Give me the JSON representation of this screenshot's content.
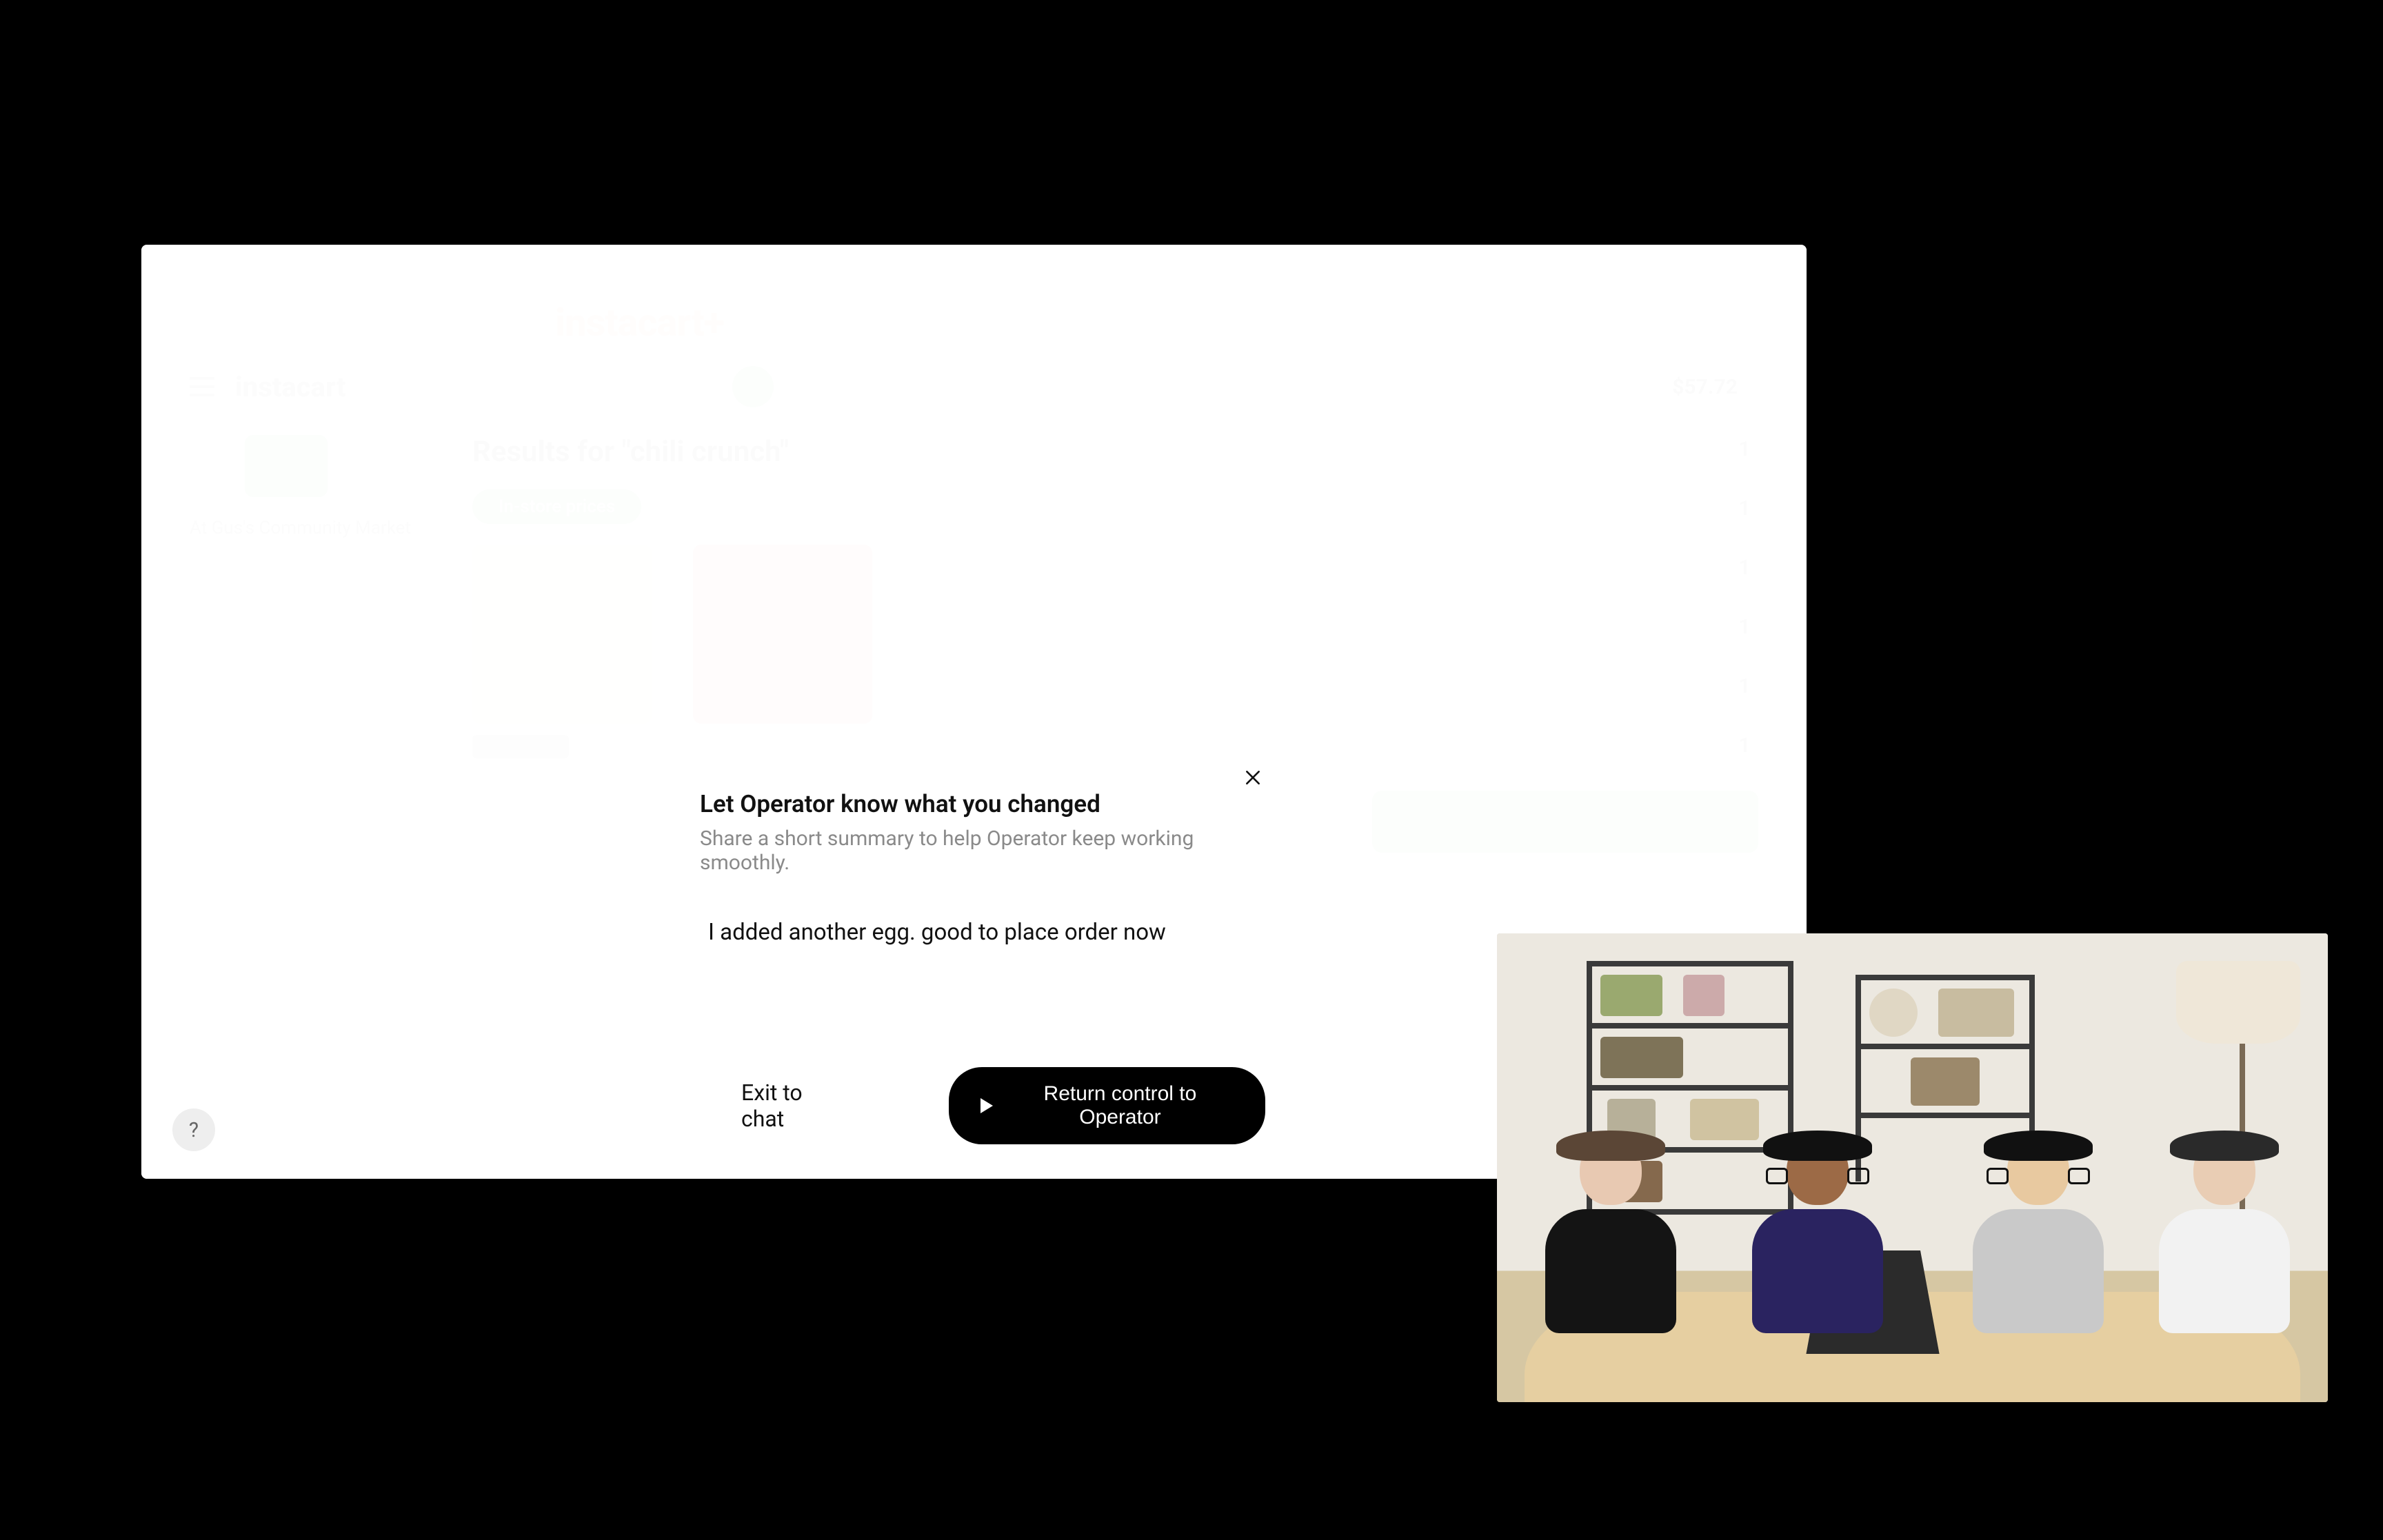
{
  "background_site": {
    "logo_text": "instacart",
    "promo_brand": "instacart+",
    "toolbar_brand": "instacart",
    "cart_total": "$57.72",
    "results_title": "Results for \"chili crunch\"",
    "chip_label": "In-store prices",
    "sidebar_store_caption": "At Gus's Community Market"
  },
  "modal": {
    "title": "Let Operator know what you changed",
    "subtitle": "Share a short summary to help Operator keep working smoothly.",
    "input_value": "I added another egg. good to place order now",
    "exit_label": "Exit to chat",
    "return_label": "Return control to Operator"
  },
  "help_bubble_label": "?",
  "pip": {
    "description": "webcam-feed-four-people-at-table"
  }
}
